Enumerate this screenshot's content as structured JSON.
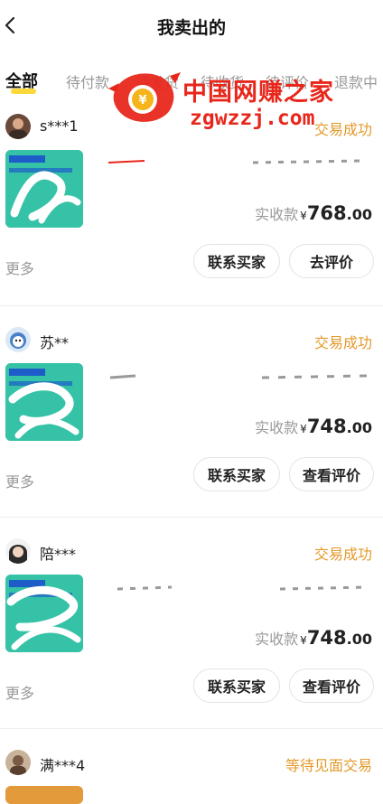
{
  "header": {
    "title": "我卖出的"
  },
  "tabs": [
    {
      "label": "全部",
      "active": true
    },
    {
      "label": "待付款"
    },
    {
      "label": "待发货"
    },
    {
      "label": "待收货"
    },
    {
      "label": "待评价"
    },
    {
      "label": "退款中"
    }
  ],
  "watermark": {
    "line1": "中国网赚之家",
    "line2": "zgwzzj.com",
    "color": "#e8271c"
  },
  "colors": {
    "accent": "#ffd83a",
    "status": "#e39a2a"
  },
  "orders": [
    {
      "buyer": "s***1",
      "status": "交易成功",
      "item_title": "",
      "price_label": "实收款",
      "currency": "¥",
      "price_int": "768",
      "price_dec": ".00",
      "more_label": "更多",
      "contact_label": "联系买家",
      "action_label": "去评价"
    },
    {
      "buyer": "苏**",
      "status": "交易成功",
      "item_title": "",
      "price_label": "实收款",
      "currency": "¥",
      "price_int": "748",
      "price_dec": ".00",
      "more_label": "更多",
      "contact_label": "联系买家",
      "action_label": "查看评价"
    },
    {
      "buyer": "陪***",
      "status": "交易成功",
      "item_title": "",
      "price_label": "实收款",
      "currency": "¥",
      "price_int": "748",
      "price_dec": ".00",
      "more_label": "更多",
      "contact_label": "联系买家",
      "action_label": "查看评价"
    },
    {
      "buyer": "满***4",
      "status": "等待见面交易"
    }
  ]
}
